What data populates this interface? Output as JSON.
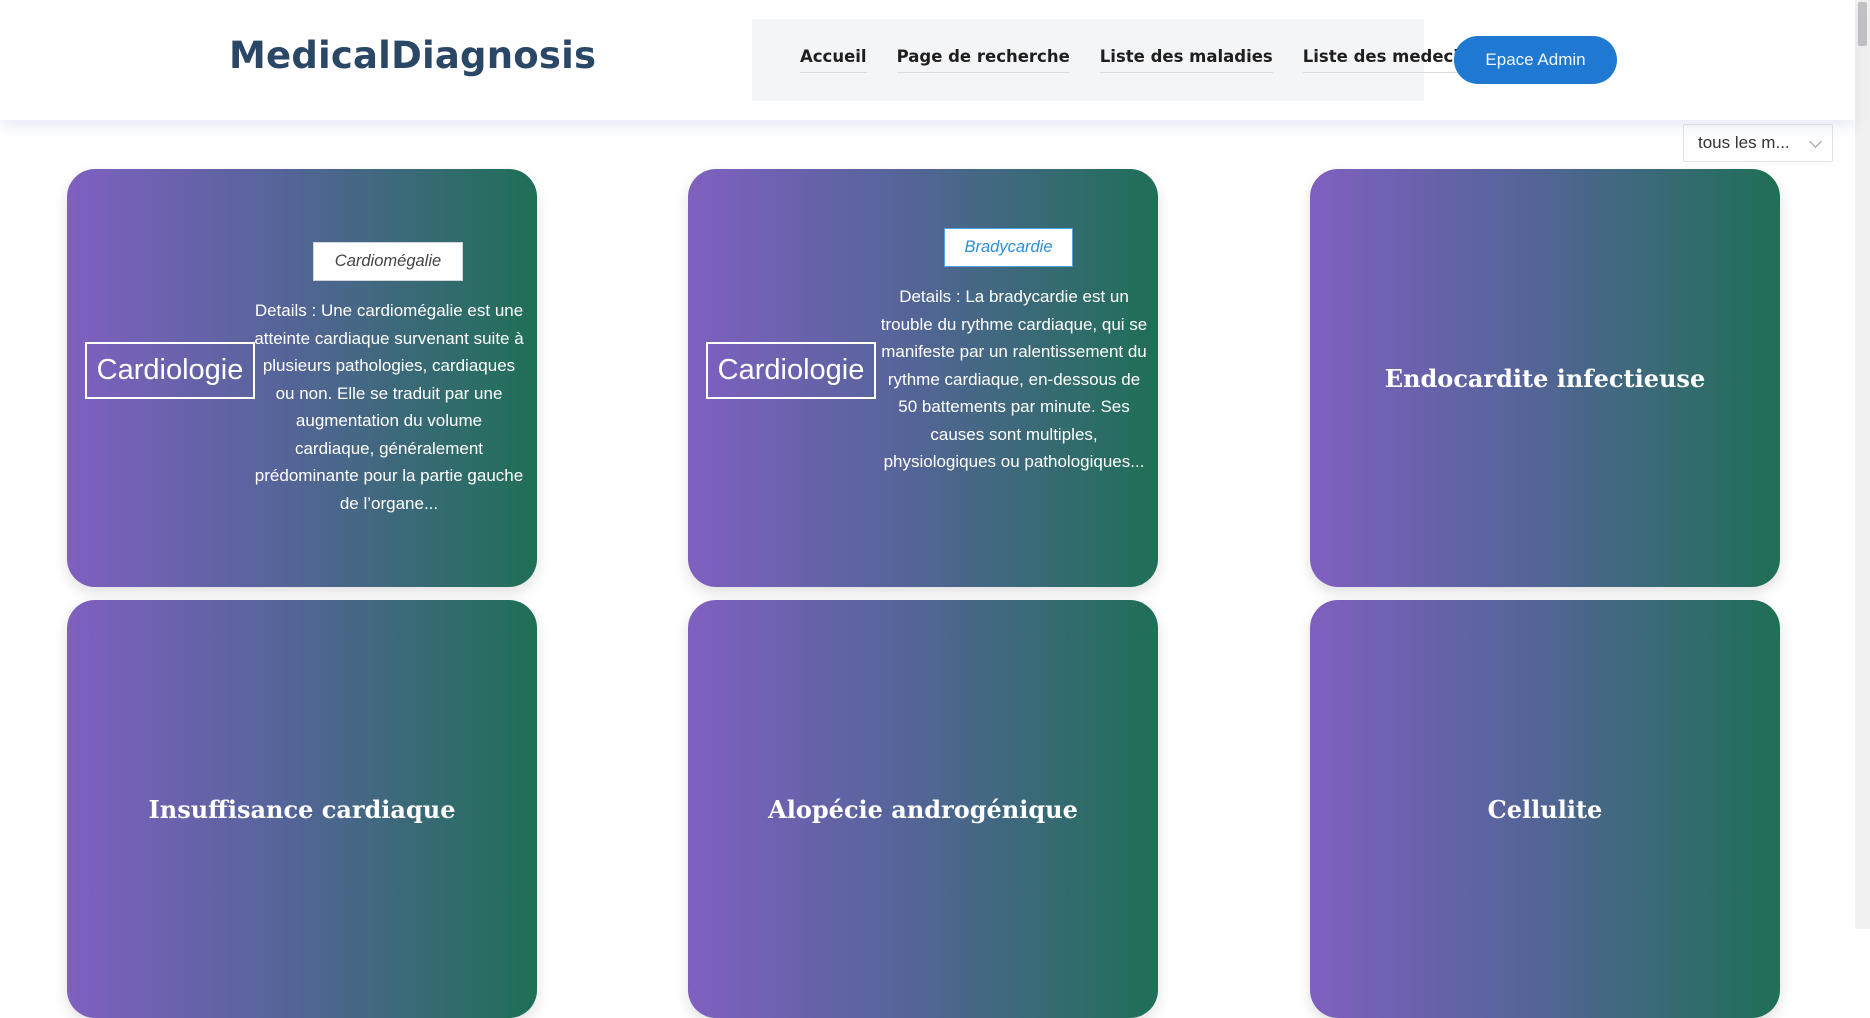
{
  "header": {
    "brand": "MedicalDiagnosis",
    "nav": [
      "Accueil",
      "Page de recherche",
      "Liste des maladies",
      "Liste des medecins"
    ],
    "admin_button": "Epace Admin"
  },
  "filter": {
    "selected": "tous les m..."
  },
  "colors": {
    "brand": "#2b4766",
    "accent": "#1f78d1",
    "gradient_start": "#7f60c0",
    "gradient_end": "#1f6f56"
  },
  "cards": [
    {
      "category": "Cardiologie",
      "name": "Cardiomégalie",
      "details": "Details : Une cardiomégalie est une atteinte cardiaque survenant suite à plusieurs pathologies, cardiaques ou non. Elle se traduit par une augmentation du volume cardiaque, généralement prédominante pour la partie gauche de l’organe..."
    },
    {
      "category": "Cardiologie",
      "name": "Bradycardie",
      "details": "Details : La bradycardie est un trouble du rythme cardiaque, qui se manifeste par un ralentissement du rythme cardiaque, en-dessous de 50 battements par minute. Ses causes sont multiples, physiologiques ou pathologiques..."
    },
    {
      "title": "Endocardite infectieuse"
    },
    {
      "title": "Insuffisance cardiaque"
    },
    {
      "title": "Alopécie androgénique"
    },
    {
      "title": "Cellulite"
    }
  ]
}
